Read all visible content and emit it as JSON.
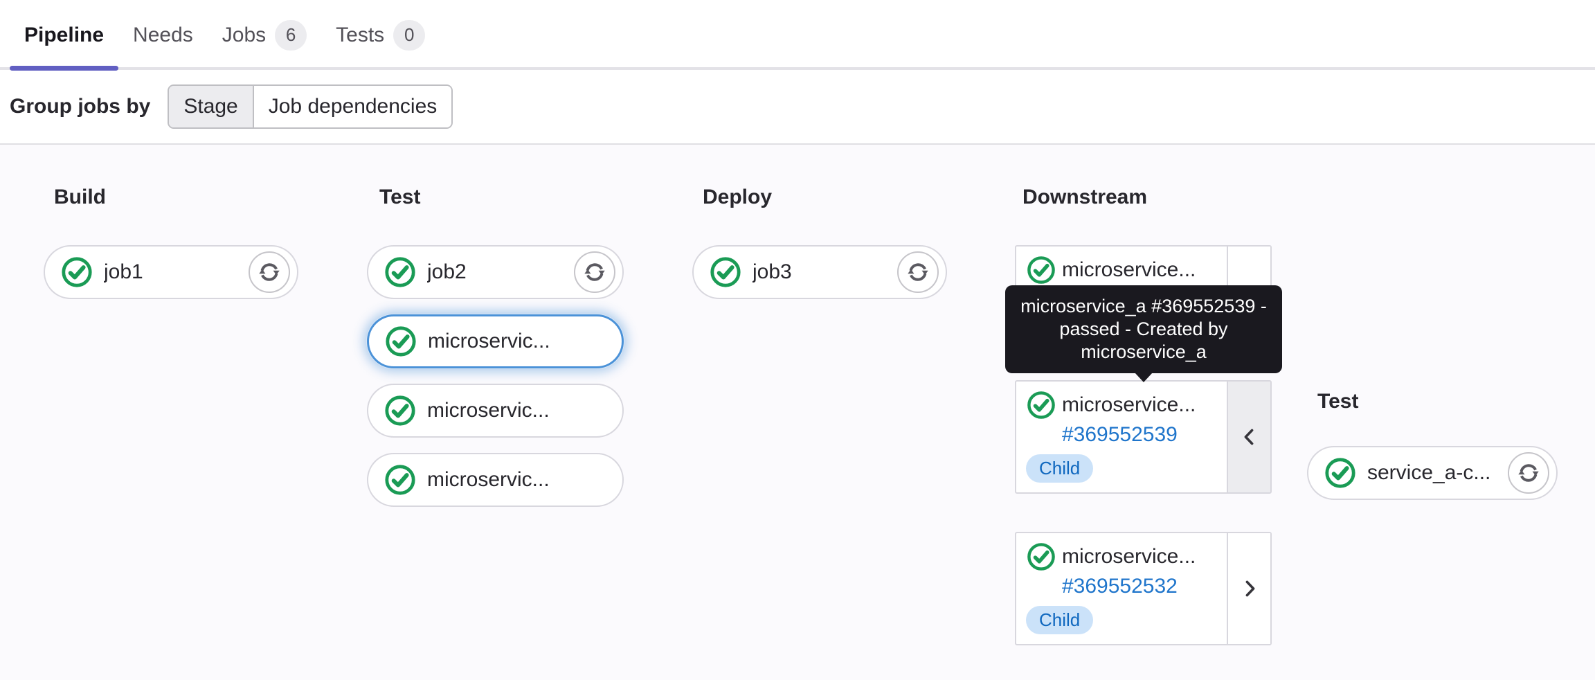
{
  "tabs": [
    {
      "label": "Pipeline",
      "active": true
    },
    {
      "label": "Needs",
      "active": false
    },
    {
      "label": "Jobs",
      "count": "6",
      "active": false
    },
    {
      "label": "Tests",
      "count": "0",
      "active": false
    }
  ],
  "group_by": {
    "label": "Group jobs by",
    "options": [
      {
        "label": "Stage",
        "selected": true
      },
      {
        "label": "Job dependencies",
        "selected": false
      }
    ]
  },
  "stages": [
    {
      "title": "Build"
    },
    {
      "title": "Test"
    },
    {
      "title": "Deploy"
    },
    {
      "title": "Downstream"
    },
    {
      "title": "Test"
    }
  ],
  "jobs": {
    "build": [
      {
        "name": "job1",
        "status": "passed",
        "retryable": true
      }
    ],
    "test": [
      {
        "name": "job2",
        "status": "passed",
        "retryable": true
      },
      {
        "name": "microservic...",
        "status": "passed",
        "selected": true
      },
      {
        "name": "microservic...",
        "status": "passed"
      },
      {
        "name": "microservic...",
        "status": "passed"
      }
    ],
    "deploy": [
      {
        "name": "job3",
        "status": "passed",
        "retryable": true
      }
    ],
    "downstream_test": [
      {
        "name": "service_a-c...",
        "status": "passed",
        "retryable": true
      }
    ]
  },
  "downstream_cards": [
    {
      "name": "microservice...",
      "status": "passed"
    },
    {
      "name": "microservice...",
      "pipeline_link": "#369552539",
      "badge": "Child",
      "status": "passed",
      "expanded": true,
      "chevron": "left"
    },
    {
      "name": "microservice...",
      "pipeline_link": "#369552532",
      "badge": "Child",
      "status": "passed",
      "expanded": false,
      "chevron": "right"
    }
  ],
  "tooltip": {
    "line1": "microservice_a #369552539 -",
    "line2": "passed - Created by",
    "line3": "microservice_a"
  },
  "colors": {
    "accent_purple": "#615fc2",
    "success_green": "#1a9b55",
    "link_blue": "#1f75cb",
    "child_badge_bg": "#cbe2f9",
    "child_badge_text": "#1068bf",
    "tooltip_bg": "#1a191f",
    "graph_bg": "#fbfafd",
    "selected_ring_blue": "#4b92d8"
  }
}
